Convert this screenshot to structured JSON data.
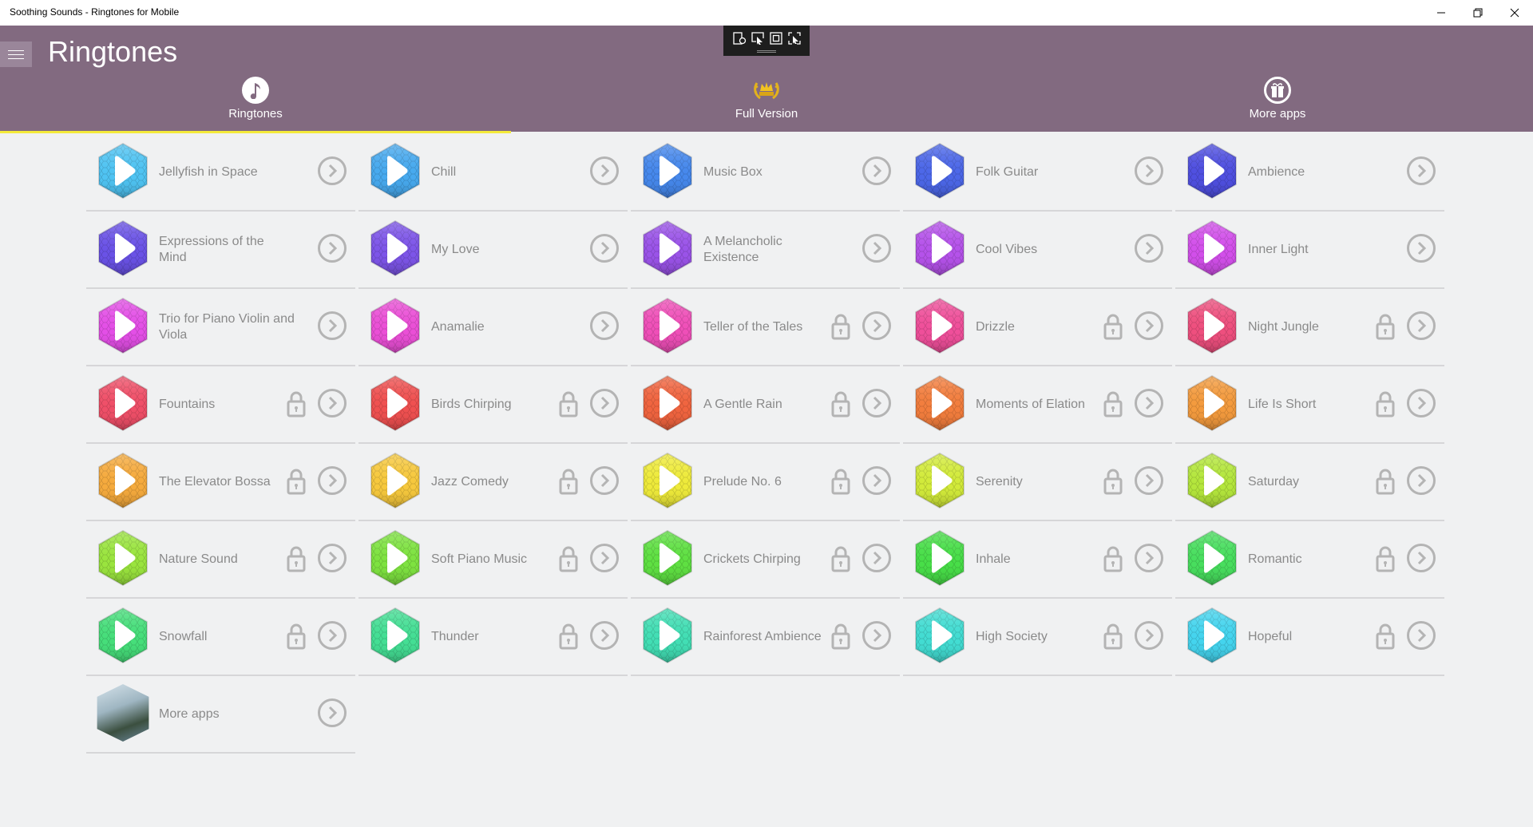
{
  "window": {
    "title": "Soothing Sounds - Ringtones for Mobile",
    "controls": [
      "minimize-icon",
      "restore-icon",
      "close-icon"
    ]
  },
  "header": {
    "title": "Ringtones",
    "menu_icon": "hamburger-icon",
    "background": "#826a80",
    "accent": "#f4ea3a"
  },
  "devtoolbar": {
    "icons": [
      "select-element-icon",
      "pointer-icon",
      "frame-icon",
      "inspect-icon"
    ]
  },
  "tabs": [
    {
      "label": "Ringtones",
      "icon": "music-note-icon",
      "active": true
    },
    {
      "label": "Full Version",
      "icon": "crown-laurel-icon",
      "active": false
    },
    {
      "label": "More apps",
      "icon": "gift-icon",
      "active": false
    }
  ],
  "ringtones": [
    {
      "name": "Jellyfish in Space",
      "color": "#4fc3f2",
      "locked": false
    },
    {
      "name": "Chill",
      "color": "#47a9ee",
      "locked": false
    },
    {
      "name": "Music Box",
      "color": "#4688ec",
      "locked": false
    },
    {
      "name": "Folk Guitar",
      "color": "#4c67e8",
      "locked": false
    },
    {
      "name": "Ambience",
      "color": "#4f4fe0",
      "locked": false
    },
    {
      "name": "Expressions of the Mind",
      "color": "#6a52e6",
      "locked": false
    },
    {
      "name": "My Love",
      "color": "#7d55e8",
      "locked": false
    },
    {
      "name": "A Melancholic Existence",
      "color": "#9a53e8",
      "locked": false
    },
    {
      "name": "Cool Vibes",
      "color": "#b552ea",
      "locked": false
    },
    {
      "name": "Inner Light",
      "color": "#d24fea",
      "locked": false
    },
    {
      "name": "Trio for Piano Violin and Viola",
      "color": "#e34fe6",
      "locked": false
    },
    {
      "name": "Anamalie",
      "color": "#ea4fd6",
      "locked": false
    },
    {
      "name": "Teller of the Tales",
      "color": "#ef4fb8",
      "locked": true
    },
    {
      "name": "Drizzle",
      "color": "#ef4f9a",
      "locked": true
    },
    {
      "name": "Night Jungle",
      "color": "#ee4f7e",
      "locked": true
    },
    {
      "name": "Fountains",
      "color": "#ef4f68",
      "locked": true
    },
    {
      "name": "Birds Chirping",
      "color": "#ef5050",
      "locked": true
    },
    {
      "name": "A Gentle Rain",
      "color": "#f0643f",
      "locked": true
    },
    {
      "name": "Moments of Elation",
      "color": "#f27d3d",
      "locked": true
    },
    {
      "name": "Life Is Short",
      "color": "#f39a3d",
      "locked": true
    },
    {
      "name": "The Elevator Bossa",
      "color": "#f5aa3d",
      "locked": true
    },
    {
      "name": "Jazz Comedy",
      "color": "#f6c83d",
      "locked": true
    },
    {
      "name": "Prelude No. 6",
      "color": "#eeea3a",
      "locked": true
    },
    {
      "name": "Serenity",
      "color": "#d2ea3a",
      "locked": true
    },
    {
      "name": "Saturday",
      "color": "#b4e63c",
      "locked": true
    },
    {
      "name": "Nature Sound",
      "color": "#9ae43e",
      "locked": true
    },
    {
      "name": "Soft Piano Music",
      "color": "#7ee240",
      "locked": true
    },
    {
      "name": "Crickets Chirping",
      "color": "#5fe042",
      "locked": true
    },
    {
      "name": "Inhale",
      "color": "#48de48",
      "locked": true
    },
    {
      "name": "Romantic",
      "color": "#48de5e",
      "locked": true
    },
    {
      "name": "Snowfall",
      "color": "#46de7a",
      "locked": true
    },
    {
      "name": "Thunder",
      "color": "#44de94",
      "locked": true
    },
    {
      "name": "Rainforest Ambience",
      "color": "#42deb4",
      "locked": true
    },
    {
      "name": "High Society",
      "color": "#42dcd2",
      "locked": true
    },
    {
      "name": "Hopeful",
      "color": "#44d4ee",
      "locked": true
    }
  ],
  "more_apps_item": {
    "name": "More apps"
  }
}
